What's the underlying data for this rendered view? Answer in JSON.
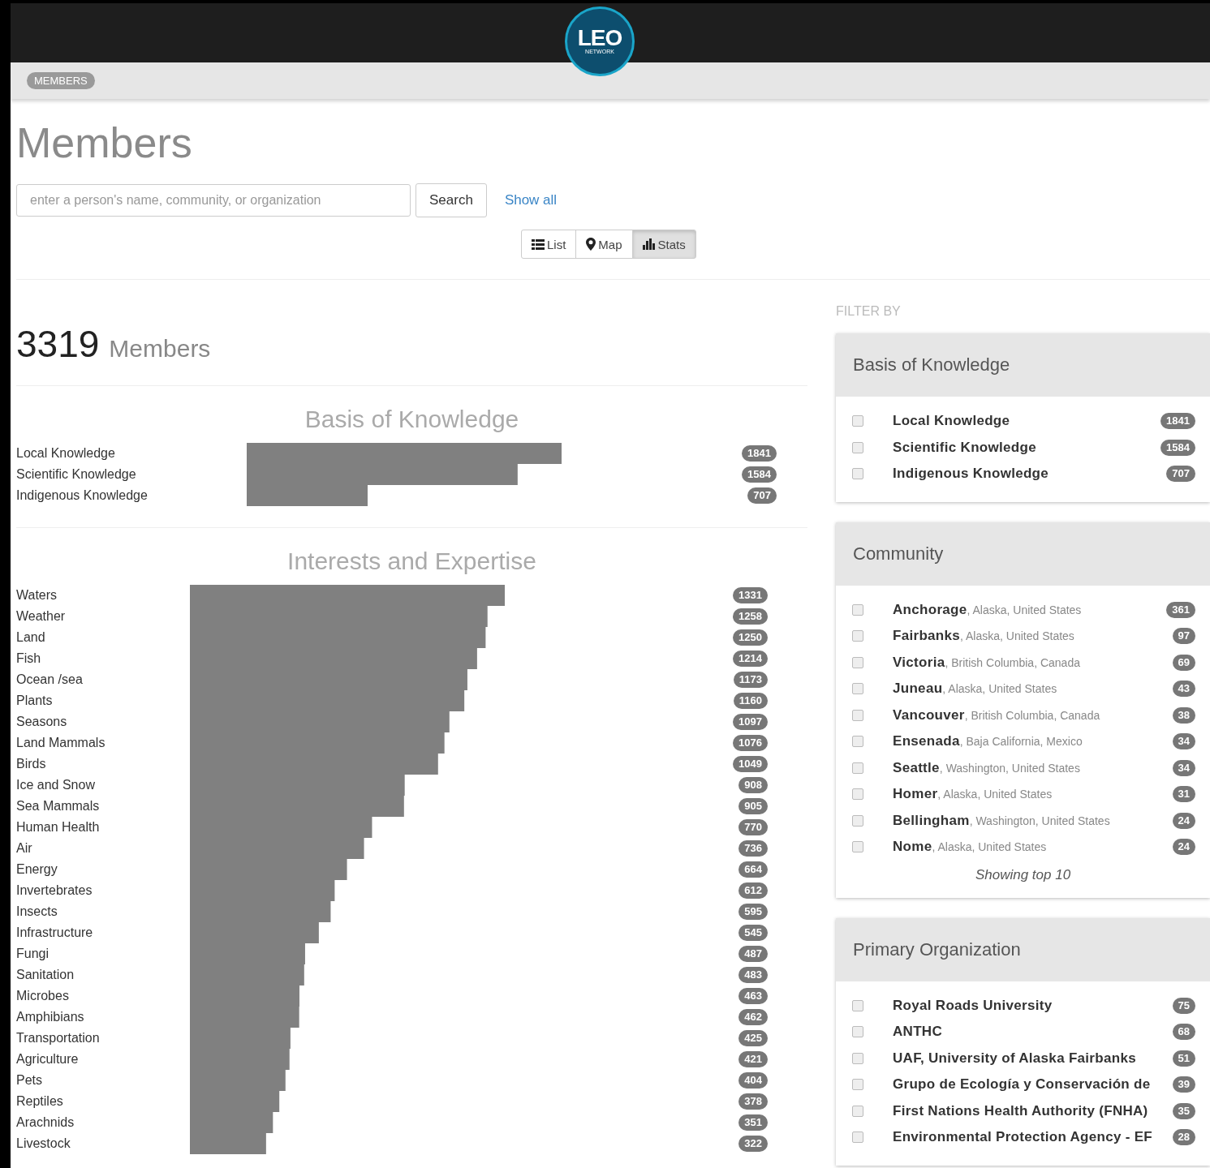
{
  "header": {
    "logo_text": "LEO",
    "logo_subtext": "NETWORK"
  },
  "breadcrumb": [
    "MEMBERS"
  ],
  "page_title": "Members",
  "search": {
    "placeholder": "enter a person's name, community, or organization",
    "button": "Search",
    "show_all": "Show all"
  },
  "view_tabs": [
    {
      "kind": "list",
      "label": "List",
      "selected": false
    },
    {
      "kind": "map",
      "label": "Map",
      "selected": false
    },
    {
      "kind": "stats",
      "label": "Stats",
      "selected": true
    }
  ],
  "total": {
    "count": "3319",
    "label": "Members"
  },
  "charts": [
    {
      "chart_data": {
        "type": "bar",
        "orientation": "horizontal",
        "title": "Basis of Knowledge",
        "data_labels": true,
        "categories": [
          "Local Knowledge",
          "Scientific Knowledge",
          "Indigenous Knowledge"
        ],
        "values": [
          1841,
          1584,
          707
        ]
      }
    },
    {
      "chart_data": {
        "type": "bar",
        "orientation": "horizontal",
        "title": "Interests and Expertise",
        "data_labels": true,
        "categories": [
          "Waters",
          "Weather",
          "Land",
          "Fish",
          "Ocean /sea",
          "Plants",
          "Seasons",
          "Land Mammals",
          "Birds",
          "Ice and Snow",
          "Sea Mammals",
          "Human Health",
          "Air",
          "Energy",
          "Invertebrates",
          "Insects",
          "Infrastructure",
          "Fungi",
          "Sanitation",
          "Microbes",
          "Amphibians",
          "Transportation",
          "Agriculture",
          "Pets",
          "Reptiles",
          "Arachnids",
          "Livestock"
        ],
        "values": [
          1331,
          1258,
          1250,
          1214,
          1173,
          1160,
          1097,
          1076,
          1049,
          908,
          905,
          770,
          736,
          664,
          612,
          595,
          545,
          487,
          483,
          463,
          462,
          425,
          421,
          404,
          378,
          351,
          322
        ]
      }
    }
  ],
  "filter": {
    "heading": "FILTER BY",
    "panels": [
      {
        "title": "Basis of Knowledge",
        "items": [
          {
            "name": "Local Knowledge",
            "count": "1841",
            "checked": false
          },
          {
            "name": "Scientific Knowledge",
            "count": "1584",
            "checked": false
          },
          {
            "name": "Indigenous Knowledge",
            "count": "707",
            "checked": false
          }
        ]
      },
      {
        "title": "Community",
        "footer": "Showing top 10",
        "items": [
          {
            "name": "Anchorage",
            "location": ", Alaska, United States",
            "count": "361",
            "checked": false
          },
          {
            "name": "Fairbanks",
            "location": ", Alaska, United States",
            "count": "97",
            "checked": false
          },
          {
            "name": "Victoria",
            "location": ", British Columbia, Canada",
            "count": "69",
            "checked": false
          },
          {
            "name": "Juneau",
            "location": ", Alaska, United States",
            "count": "43",
            "checked": false
          },
          {
            "name": "Vancouver",
            "location": ", British Columbia, Canada",
            "count": "38",
            "checked": false
          },
          {
            "name": "Ensenada",
            "location": ", Baja California, Mexico",
            "count": "34",
            "checked": false
          },
          {
            "name": "Seattle",
            "location": ", Washington, United States",
            "count": "34",
            "checked": false
          },
          {
            "name": "Homer",
            "location": ", Alaska, United States",
            "count": "31",
            "checked": false
          },
          {
            "name": "Bellingham",
            "location": ", Washington, United States",
            "count": "24",
            "checked": false
          },
          {
            "name": "Nome",
            "location": ", Alaska, United States",
            "count": "24",
            "checked": false
          }
        ]
      },
      {
        "title": "Primary Organization",
        "items": [
          {
            "name": "Royal Roads University",
            "count": "75",
            "checked": false
          },
          {
            "name": "ANTHC",
            "count": "68",
            "checked": false
          },
          {
            "name": "UAF, University of Alaska Fairbanks",
            "count": "51",
            "checked": false
          },
          {
            "name": "Grupo de Ecología y Conservación de",
            "count": "39",
            "checked": false
          },
          {
            "name": "First Nations Health Authority (FNHA)",
            "count": "35",
            "checked": false
          },
          {
            "name": "Environmental Protection Agency - EF",
            "count": "28",
            "checked": false
          }
        ]
      }
    ]
  }
}
